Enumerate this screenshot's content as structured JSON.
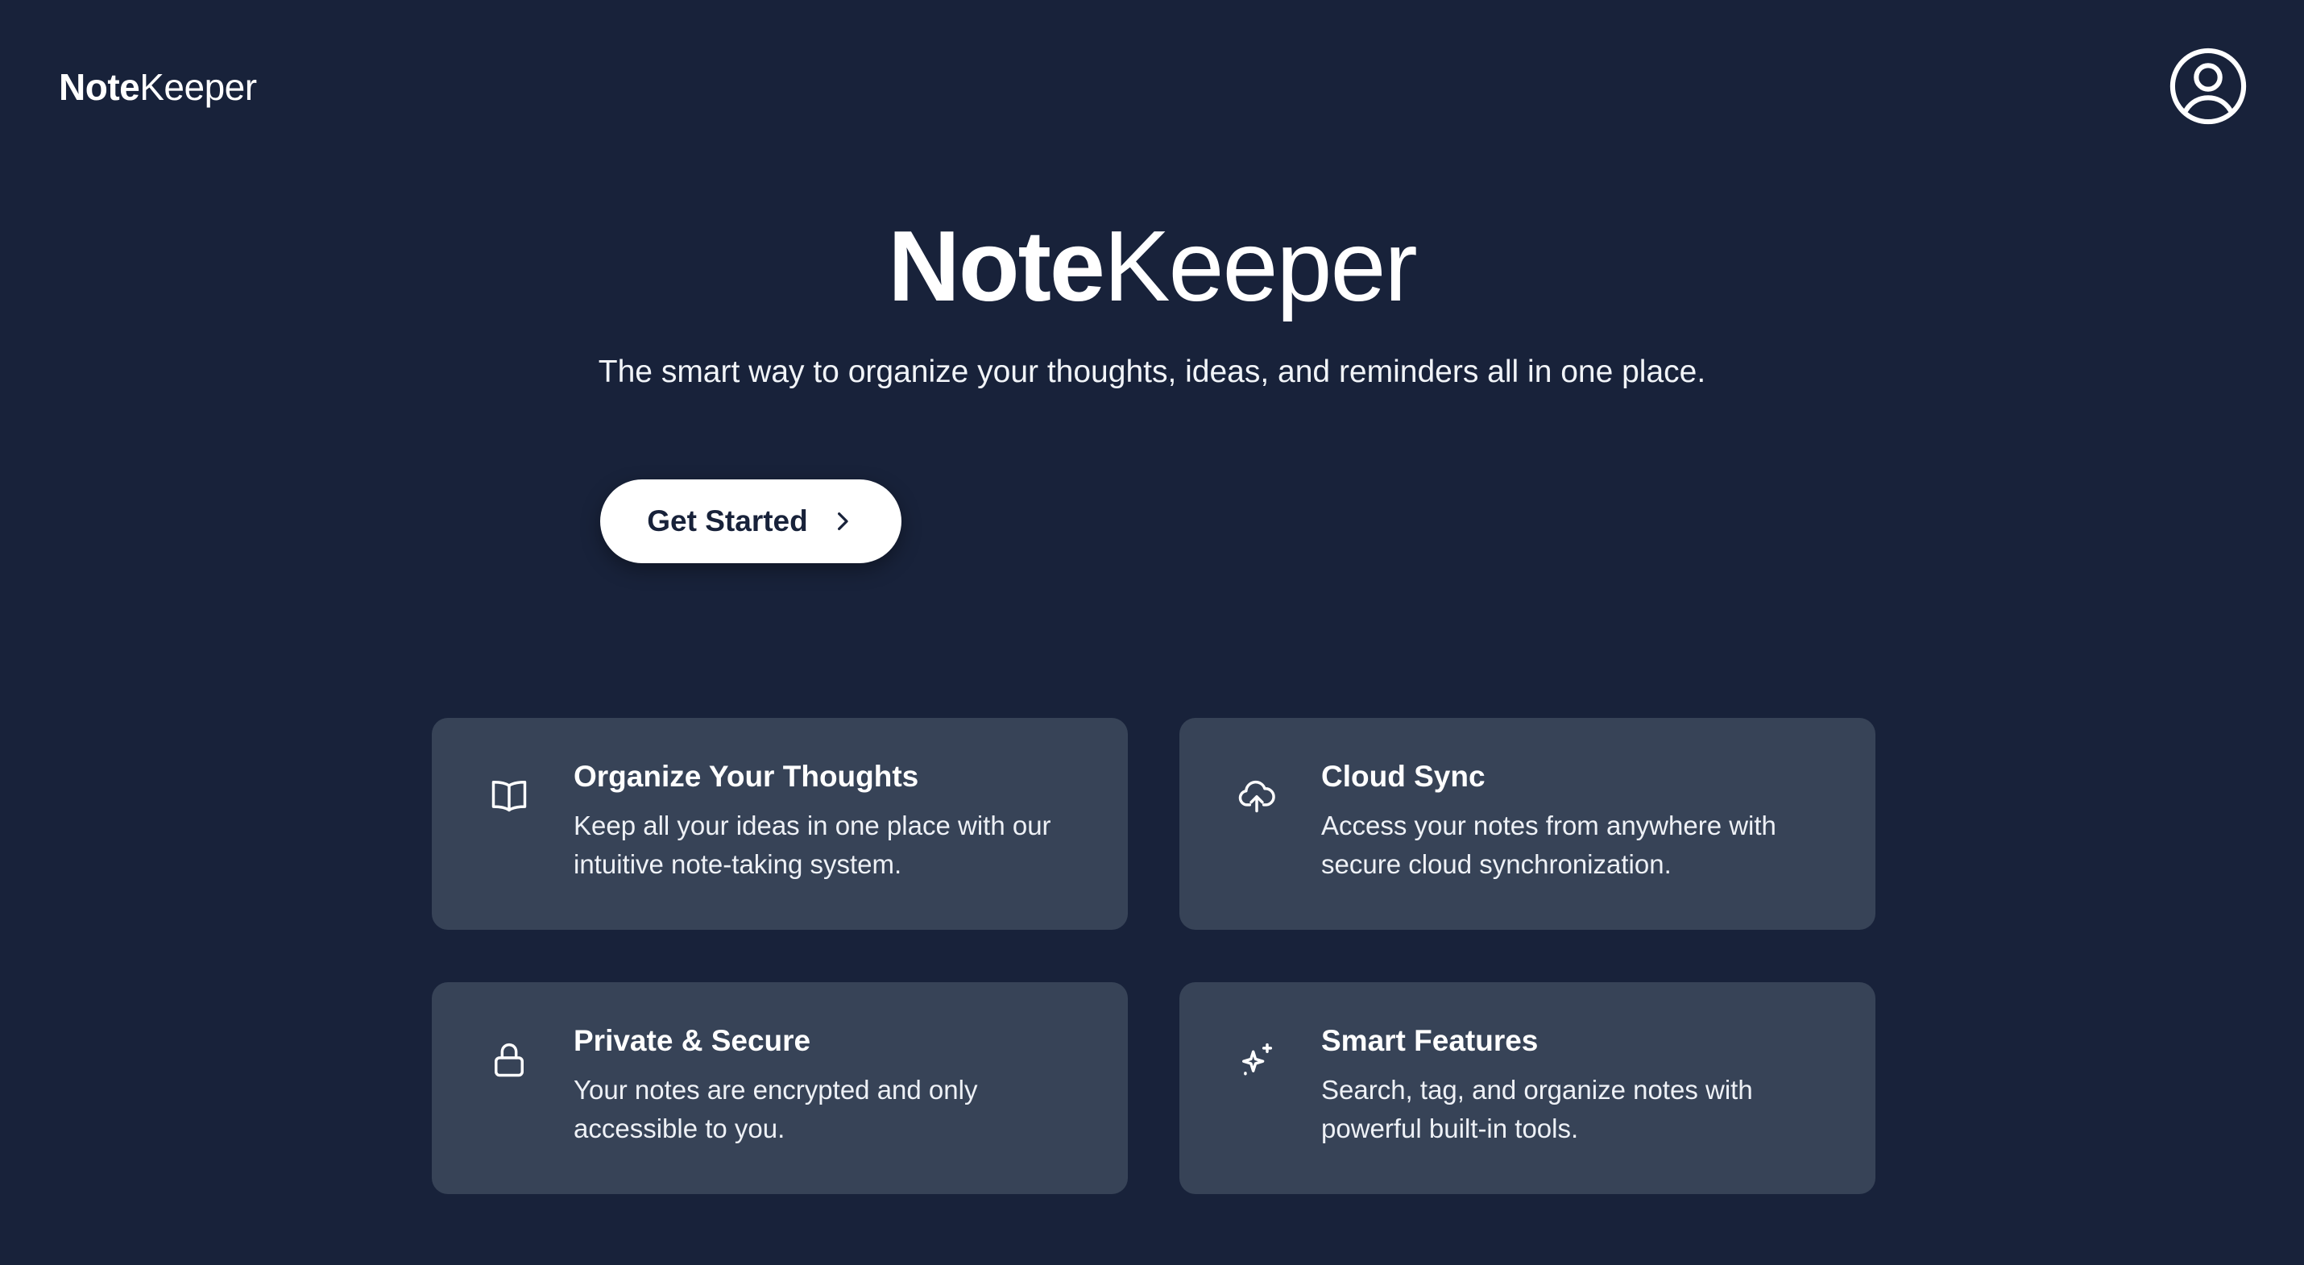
{
  "header": {
    "brand_bold": "Note",
    "brand_light": "Keeper",
    "profile_icon": "user-circle-icon"
  },
  "hero": {
    "title_bold": "Note",
    "title_light": "Keeper",
    "subtitle": "The smart way to organize your thoughts, ideas, and reminders all in one place.",
    "cta_label": "Get Started",
    "cta_icon": "chevron-right-icon"
  },
  "features": [
    {
      "icon": "book-open-icon",
      "title": "Organize Your Thoughts",
      "description": "Keep all your ideas in one place with our intuitive note-taking system."
    },
    {
      "icon": "cloud-upload-icon",
      "title": "Cloud Sync",
      "description": "Access your notes from anywhere with secure cloud synchronization."
    },
    {
      "icon": "lock-icon",
      "title": "Private & Secure",
      "description": "Your notes are encrypted and only accessible to you."
    },
    {
      "icon": "sparkles-icon",
      "title": "Smart Features",
      "description": "Search, tag, and organize notes with powerful built-in tools."
    }
  ],
  "colors": {
    "background": "#18223a",
    "card": "#374357",
    "text": "#ffffff",
    "button_bg": "#ffffff",
    "button_text": "#18223a"
  }
}
